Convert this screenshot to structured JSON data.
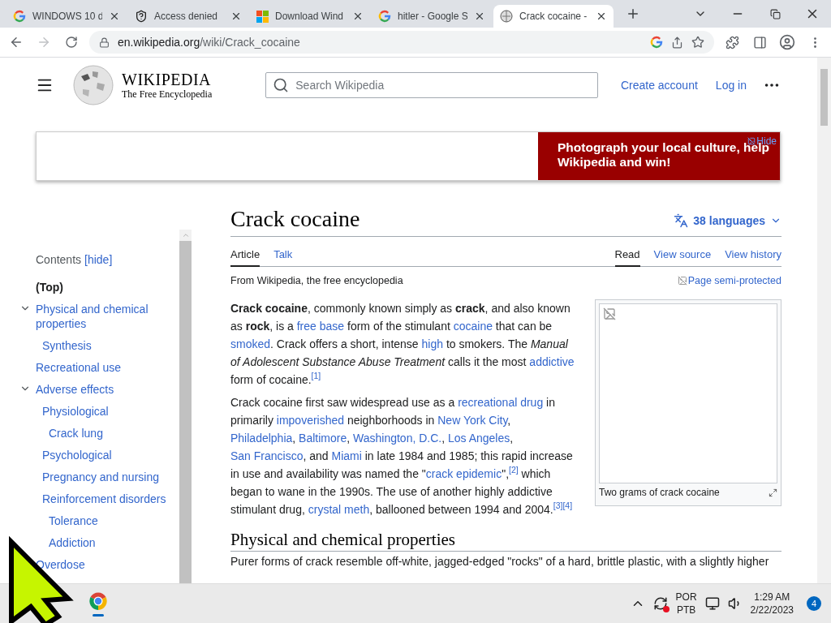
{
  "browser": {
    "tabs": [
      {
        "title": "WINDOWS 10 d",
        "kind": "google",
        "selected": false
      },
      {
        "title": "Access denied",
        "kind": "shield",
        "selected": false
      },
      {
        "title": "Download Wind",
        "kind": "microsoft",
        "selected": false
      },
      {
        "title": "hitler - Google S",
        "kind": "google",
        "selected": false
      },
      {
        "title": "Crack cocaine -",
        "kind": "wikipedia",
        "selected": true
      }
    ],
    "forward_disabled": true,
    "address": {
      "host": "en.wikipedia.org",
      "path": "/wiki/Crack_cocaine"
    }
  },
  "header": {
    "wordmark": "WIKIPEDIA",
    "tagline": "The Free Encyclopedia",
    "search": {
      "placeholder": "Search Wikipedia"
    },
    "links": [
      "Create account",
      "Log in"
    ]
  },
  "banner": {
    "text": "Photograph your local culture, help Wikipedia and win!",
    "hide": "Hide"
  },
  "toc": {
    "title": "Contents",
    "hide": "[hide]",
    "items": [
      {
        "label": "(Top)",
        "selected": true
      },
      {
        "label": "Physical and chemical properties",
        "selected": false,
        "expanded": true,
        "children": [
          {
            "label": "Synthesis",
            "selected": false
          }
        ]
      },
      {
        "label": "Recreational use",
        "selected": false
      },
      {
        "label": "Adverse effects",
        "selected": false,
        "expanded": true,
        "children": [
          {
            "label": "Physiological",
            "selected": false,
            "children": [
              {
                "label": "Crack lung",
                "selected": false
              }
            ]
          },
          {
            "label": "Psychological",
            "selected": false
          },
          {
            "label": "Pregnancy and nursing",
            "selected": false
          },
          {
            "label": "Reinforcement disorders",
            "selected": false,
            "children": [
              {
                "label": "Tolerance",
                "selected": false
              },
              {
                "label": "Addiction",
                "selected": false
              }
            ]
          }
        ]
      },
      {
        "label": "Overdose",
        "selected": false
      }
    ]
  },
  "article": {
    "title": "Crack cocaine",
    "languages": "38 languages",
    "tabs_left": [
      {
        "label": "Article",
        "selected": true
      },
      {
        "label": "Talk",
        "selected": false
      }
    ],
    "tabs_right": [
      {
        "label": "Read",
        "selected": true
      },
      {
        "label": "View source",
        "selected": false
      },
      {
        "label": "View history",
        "selected": false
      }
    ],
    "tagline": "From Wikipedia, the free encyclopedia",
    "protection": "Page semi-protected",
    "paragraphs": [
      [
        {
          "kind": "text",
          "text": "**Crack cocaine**, commonly known simply as **crack**, and also known as **rock**, is a "
        },
        {
          "kind": "link",
          "text": "free base"
        },
        {
          "kind": "text",
          "text": " form of the stimulant "
        },
        {
          "kind": "link",
          "text": "cocaine"
        },
        {
          "kind": "text",
          "text": " that can be "
        },
        {
          "kind": "link",
          "text": "smoked"
        },
        {
          "kind": "text",
          "text": ". Crack offers a short, intense "
        },
        {
          "kind": "link",
          "text": "high"
        },
        {
          "kind": "text",
          "text": " to smokers. The *Manual of Adolescent Substance Abuse Treatment* calls it the most "
        },
        {
          "kind": "link",
          "text": "addictive"
        },
        {
          "kind": "text",
          "text": " form of cocaine."
        },
        {
          "kind": "ref",
          "text": "[1]"
        }
      ],
      [
        {
          "kind": "text",
          "text": "Crack cocaine first saw widespread use as a "
        },
        {
          "kind": "link",
          "text": "recreational drug"
        },
        {
          "kind": "text",
          "text": " in primarily "
        },
        {
          "kind": "link",
          "text": "impoverished"
        },
        {
          "kind": "text",
          "text": " neighborhoods in "
        },
        {
          "kind": "link",
          "text": "New York City"
        },
        {
          "kind": "text",
          "text": ", "
        },
        {
          "kind": "link",
          "text": "Philadelphia"
        },
        {
          "kind": "text",
          "text": ", "
        },
        {
          "kind": "link",
          "text": "Baltimore"
        },
        {
          "kind": "text",
          "text": ", "
        },
        {
          "kind": "link",
          "text": "Washington, D.C."
        },
        {
          "kind": "text",
          "text": ", "
        },
        {
          "kind": "link",
          "text": "Los Angeles"
        },
        {
          "kind": "text",
          "text": ", "
        },
        {
          "kind": "link",
          "text": "San Francisco"
        },
        {
          "kind": "text",
          "text": ", and "
        },
        {
          "kind": "link",
          "text": "Miami"
        },
        {
          "kind": "text",
          "text": " in late 1984 and 1985; this rapid increase in use and availability was named the \""
        },
        {
          "kind": "link",
          "text": "crack epidemic"
        },
        {
          "kind": "text",
          "text": "\","
        },
        {
          "kind": "ref",
          "text": "[2]"
        },
        {
          "kind": "text",
          "text": " which began to wane in the 1990s. The use of another highly addictive stimulant drug, "
        },
        {
          "kind": "link",
          "text": "crystal meth"
        },
        {
          "kind": "text",
          "text": ", ballooned between 1994 and 2004."
        },
        {
          "kind": "ref",
          "text": "[3]"
        },
        {
          "kind": "ref",
          "text": "[4]"
        }
      ]
    ],
    "figure": {
      "caption": "Two grams of crack cocaine"
    },
    "heading": "Physical and chemical properties",
    "cut_paragraph": "Purer forms of crack resemble off-white, jagged-edged \"rocks\" of a hard, brittle plastic, with a slightly higher"
  },
  "taskbar": {
    "language": [
      "POR",
      "PTB"
    ],
    "time": "1:29 AM",
    "date": "2/22/2023",
    "notifications": "4"
  }
}
